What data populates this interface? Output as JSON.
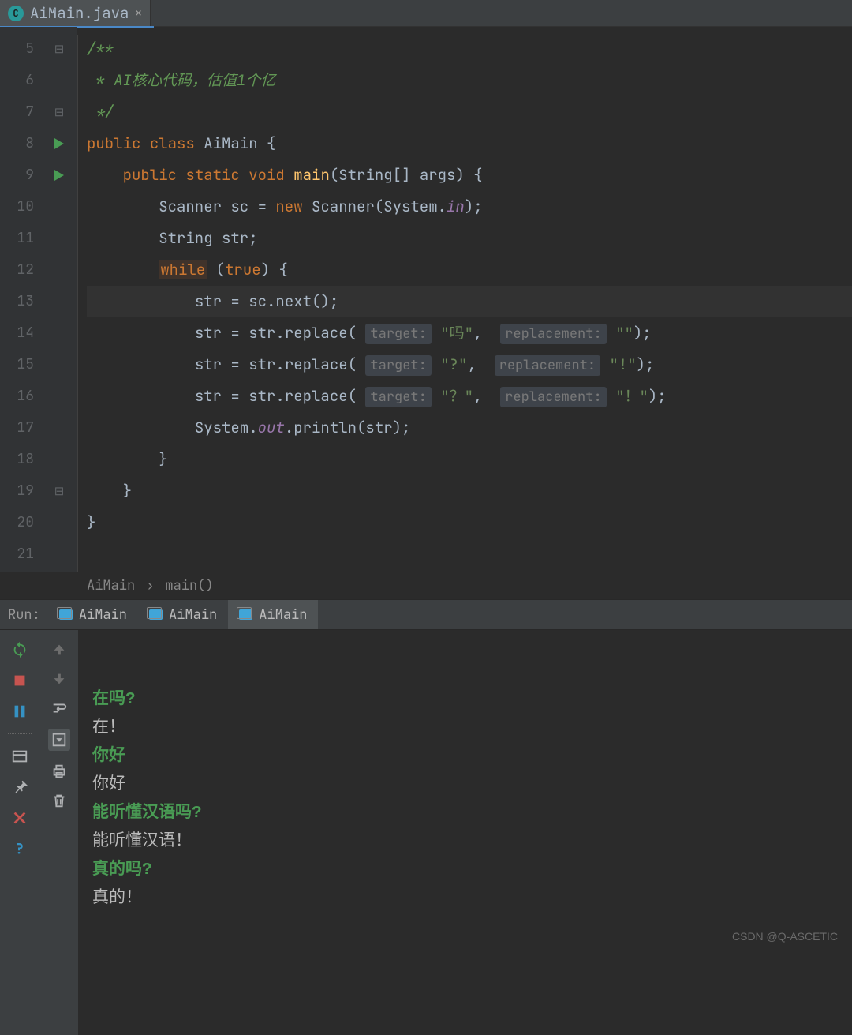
{
  "tab": {
    "filename": "AiMain.java"
  },
  "gutter": {
    "lines": [
      "5",
      "6",
      "7",
      "8",
      "9",
      "10",
      "11",
      "12",
      "13",
      "14",
      "15",
      "16",
      "17",
      "18",
      "19",
      "20",
      "21"
    ]
  },
  "code": {
    "l5": "/**",
    "l6": " * AI核心代码，估值1个亿",
    "l7": " */",
    "kw_public": "public",
    "kw_class": "class",
    "name_class": "AiMain",
    "brace_o": " {",
    "kw_static": "static",
    "kw_void": "void",
    "name_main": "main",
    "main_args": "(String[] args) {",
    "l10a": "Scanner sc = ",
    "kw_new": "new",
    "l10b": " Scanner(System.",
    "static_in": "in",
    "l10c": ");",
    "l11": "String str;",
    "kw_while": "while",
    "l12": " (",
    "kw_true": "true",
    "l12b": ") {",
    "l13": "str = sc.next();",
    "rep_pre": "str = str.replace(",
    "hint_target": "target:",
    "hint_repl": "replacement:",
    "s14a": "\"吗\"",
    "s14b": "\"\"",
    "s15a": "\"?\"",
    "s15b": "\"!\"",
    "s16a": "\"？\"",
    "s16b": "\"！\"",
    "l17a": "System.",
    "static_out": "out",
    "l17b": ".println(str);",
    "brace_c": "}"
  },
  "breadcrumb": {
    "a": "AiMain",
    "sep": "›",
    "b": "main()"
  },
  "run": {
    "label": "Run:",
    "tabs": [
      "AiMain",
      "AiMain",
      "AiMain"
    ]
  },
  "console": [
    {
      "t": "inp",
      "v": "在吗?"
    },
    {
      "t": "out",
      "v": "在！"
    },
    {
      "t": "inp",
      "v": "你好"
    },
    {
      "t": "out",
      "v": "你好"
    },
    {
      "t": "inp",
      "v": "能听懂汉语吗?"
    },
    {
      "t": "out",
      "v": "能听懂汉语！"
    },
    {
      "t": "inp",
      "v": "真的吗?"
    },
    {
      "t": "out",
      "v": "真的！"
    }
  ],
  "watermark": "CSDN @Q-ASCETIC"
}
